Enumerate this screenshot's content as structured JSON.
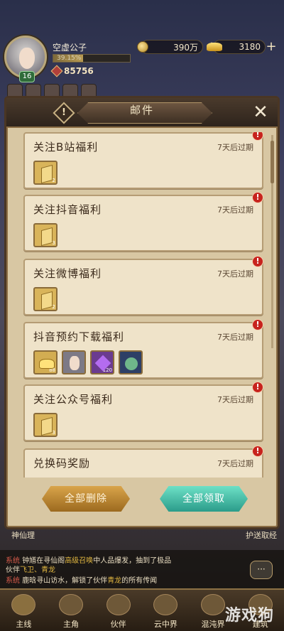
{
  "player": {
    "name": "空虚公子",
    "exp_percent": "39.15%",
    "exp_fraction": 0.3915,
    "level": "16",
    "power": "85756"
  },
  "resources": {
    "coins": "390万",
    "ingots": "3180"
  },
  "mail_panel": {
    "title": "邮件",
    "close_label": "✕",
    "warn_label": "!",
    "items": [
      {
        "subject": "关注B站福利",
        "expire": "7天后过期",
        "rewards": [
          {
            "type": "ticket",
            "count": "2"
          }
        ]
      },
      {
        "subject": "关注抖音福利",
        "expire": "7天后过期",
        "rewards": [
          {
            "type": "ticket",
            "count": "3"
          }
        ]
      },
      {
        "subject": "关注微博福利",
        "expire": "7天后过期",
        "rewards": [
          {
            "type": "ticket",
            "count": "2"
          }
        ]
      },
      {
        "subject": "抖音预约下载福利",
        "expire": "7天后过期",
        "rewards": [
          {
            "type": "ingot",
            "count": "88"
          },
          {
            "type": "hero",
            "count": ""
          },
          {
            "type": "gem",
            "count": "120"
          },
          {
            "type": "pet",
            "count": ""
          }
        ]
      },
      {
        "subject": "关注公众号福利",
        "expire": "7天后过期",
        "rewards": [
          {
            "type": "ticket",
            "count": "3"
          }
        ]
      },
      {
        "subject": "兑换码奖励",
        "expire": "7天后过期",
        "rewards": []
      }
    ],
    "delete_all_label": "全部删除",
    "claim_all_label": "全部领取"
  },
  "below_panel": {
    "left_text": "神仙理",
    "right_text": "护送取经"
  },
  "chat": {
    "line1_tag": "系统",
    "line1_a": "钟馗在寻仙阁",
    "line1_b": "高级召唤",
    "line1_c": "中人品爆发，抽到了极品",
    "line1_d": "伙伴",
    "line1_e": "飞卫、青龙",
    "line2_tag": "系统",
    "line2_a": "鹿晗",
    "line2_b": "寻山访水，解锁了伙伴",
    "line2_c": "青龙",
    "line2_d": "的所有传闻",
    "bubble": "···"
  },
  "nav": [
    {
      "label": "主线"
    },
    {
      "label": "主角"
    },
    {
      "label": "伙伴"
    },
    {
      "label": "云中界"
    },
    {
      "label": "混沌界"
    },
    {
      "label": "建筑"
    }
  ],
  "watermark": "游戏狗",
  "colors": {
    "alert_red": "#c7231d",
    "claim_teal": "#3fb8a3",
    "delete_gold": "#c08a36"
  }
}
